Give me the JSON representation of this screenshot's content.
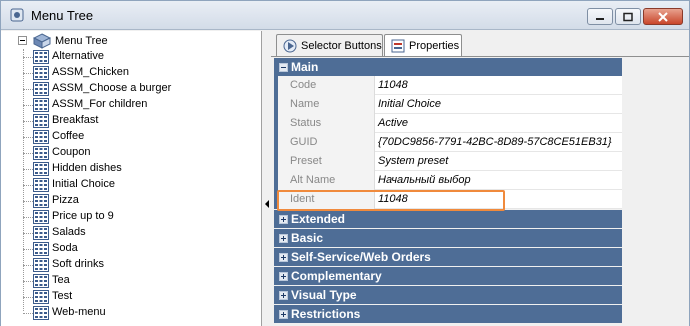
{
  "window": {
    "title": "Menu Tree"
  },
  "tree": {
    "root_label": "Menu Tree",
    "items": [
      "Alternative",
      "ASSM_Chicken",
      "ASSM_Choose a burger",
      "ASSM_For children",
      "Breakfast",
      "Coffee",
      "Coupon",
      "Hidden dishes",
      "Initial Choice",
      "Pizza",
      "Price up to 9",
      "Salads",
      "Soda",
      "Soft drinks",
      "Tea",
      "Test",
      "Web-menu"
    ]
  },
  "tabs": [
    {
      "label": "Selector Buttons",
      "icon": "selector-icon",
      "active": false
    },
    {
      "label": "Properties",
      "icon": "properties-icon",
      "active": true
    }
  ],
  "properties": {
    "main": {
      "title": "Main",
      "rows": [
        {
          "key": "Code",
          "value": "11048"
        },
        {
          "key": "Name",
          "value": "Initial Choice"
        },
        {
          "key": "Status",
          "value": "Active"
        },
        {
          "key": "GUID",
          "value": "{70DC9856-7791-42BC-8D89-57C8CE51EB31}"
        },
        {
          "key": "Preset",
          "value": "System preset"
        },
        {
          "key": "Alt Name",
          "value": "Начальный выбор"
        },
        {
          "key": "Ident",
          "value": "11048"
        }
      ]
    },
    "categories": [
      "Extended",
      "Basic",
      "Self-Service/Web Orders",
      "Complementary",
      "Visual Type",
      "Restrictions"
    ]
  },
  "colors": {
    "category_header": "#4e6d96",
    "highlight": "#f08a3c"
  }
}
